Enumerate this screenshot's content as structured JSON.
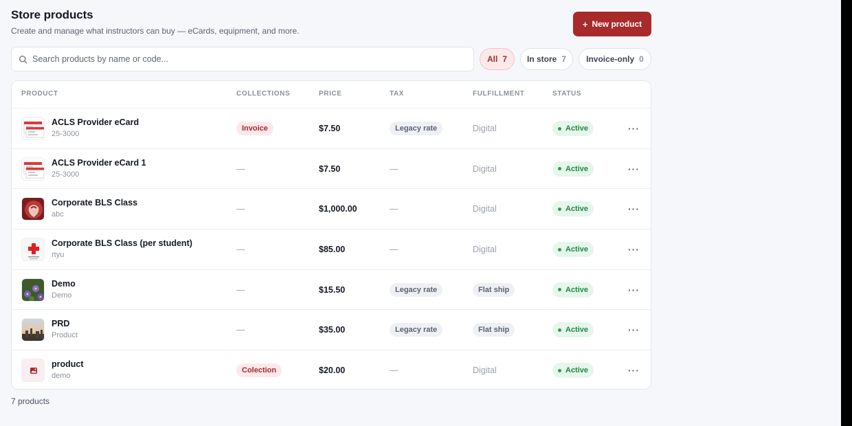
{
  "header": {
    "title": "Store products",
    "subtitle": "Create and manage what instructors can buy — eCards, equipment, and more.",
    "new_button_label": "New product"
  },
  "search": {
    "placeholder": "Search products by name or code..."
  },
  "filters": [
    {
      "label": "All",
      "count": "7",
      "active": true
    },
    {
      "label": "In store",
      "count": "7",
      "active": false
    },
    {
      "label": "Invoice-only",
      "count": "0",
      "active": false
    }
  ],
  "columns": {
    "product": "PRODUCT",
    "collections": "COLLECTIONS",
    "price": "PRICE",
    "tax": "TAX",
    "fulfillment": "FULFILLMENT",
    "status": "STATUS"
  },
  "rows": [
    {
      "name": "ACLS Provider eCard",
      "code": "25-3000",
      "thumb": "ecard",
      "collection": "Invoice",
      "price": "$7.50",
      "tax": "Legacy rate",
      "fulfillment": "Digital",
      "fulfillment_pill": false,
      "status": "Active"
    },
    {
      "name": "ACLS Provider eCard 1",
      "code": "25-3000",
      "thumb": "ecard",
      "collection": "—",
      "price": "$7.50",
      "tax": "—",
      "fulfillment": "Digital",
      "fulfillment_pill": false,
      "status": "Active"
    },
    {
      "name": "Corporate BLS Class",
      "code": "abc",
      "thumb": "heart",
      "collection": "—",
      "price": "$1,000.00",
      "tax": "—",
      "fulfillment": "Digital",
      "fulfillment_pill": false,
      "status": "Active"
    },
    {
      "name": "Corporate BLS Class (per student)",
      "code": "rtyu",
      "thumb": "redcross",
      "collection": "—",
      "price": "$85.00",
      "tax": "—",
      "fulfillment": "Digital",
      "fulfillment_pill": false,
      "status": "Active"
    },
    {
      "name": "Demo",
      "code": "Demo",
      "thumb": "flowers",
      "collection": "—",
      "price": "$15.50",
      "tax": "Legacy rate",
      "fulfillment": "Flat ship",
      "fulfillment_pill": true,
      "status": "Active"
    },
    {
      "name": "PRD",
      "code": "Product",
      "thumb": "city",
      "collection": "—",
      "price": "$35.00",
      "tax": "Legacy rate",
      "fulfillment": "Flat ship",
      "fulfillment_pill": true,
      "status": "Active"
    },
    {
      "name": "product",
      "code": "demo",
      "thumb": "placeholder",
      "collection": "Colection",
      "price": "$20.00",
      "tax": "—",
      "fulfillment": "Digital",
      "fulfillment_pill": false,
      "status": "Active"
    }
  ],
  "footer": {
    "count_label": "7 products"
  },
  "colors": {
    "accent": "#a82a2a",
    "active_green": "#1f8a44",
    "chip_active_bg": "#fde8ea"
  },
  "icons": {
    "search": "search-icon",
    "add": "plus-icon",
    "row_menu": "more-horizontal-icon",
    "status": "dot-icon"
  }
}
